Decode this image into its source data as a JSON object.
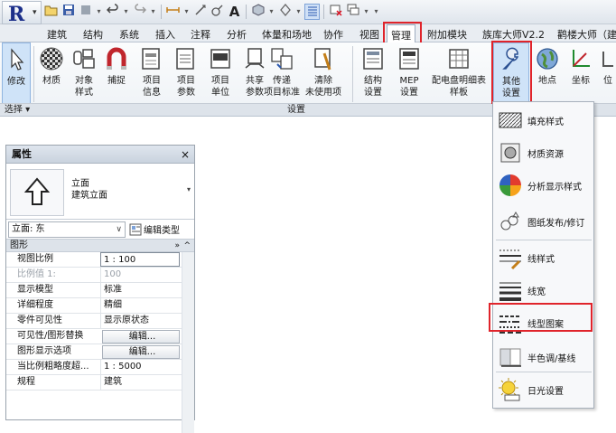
{
  "colors": {
    "highlight_box": "#e0242b",
    "ribbon_bg": "#f0f3f6",
    "selected_button": "#cfe3f8",
    "logo_letter": "#1c2f8a"
  },
  "app": {
    "logo_letter": "R"
  },
  "tabs": [
    {
      "label": "建筑"
    },
    {
      "label": "结构"
    },
    {
      "label": "系统"
    },
    {
      "label": "插入"
    },
    {
      "label": "注释"
    },
    {
      "label": "分析"
    },
    {
      "label": "体量和场地"
    },
    {
      "label": "协作"
    },
    {
      "label": "视图"
    },
    {
      "label": "管理"
    },
    {
      "label": "附加模块"
    },
    {
      "label": "族库大师V2.2"
    },
    {
      "label": "鹳楼大师（建"
    }
  ],
  "active_tab": "管理",
  "quick_access": {
    "text_tool": "A"
  },
  "ribbon": {
    "buttons": [
      {
        "label": "修改",
        "icon": "cursor-arrow-icon"
      },
      {
        "label": "材质",
        "icon": "material-sphere-icon"
      },
      {
        "label": "对象\n样式",
        "icon": "object-styles-icon"
      },
      {
        "label": "捕捉",
        "icon": "snap-magnet-icon"
      },
      {
        "label": "项目\n信息",
        "icon": "project-info-icon"
      },
      {
        "label": "项目\n参数",
        "icon": "project-parameters-icon"
      },
      {
        "label": "项目\n单位",
        "icon": "project-units-icon"
      },
      {
        "label": "共享\n参数",
        "icon": "shared-parameters-icon"
      },
      {
        "label": "传递\n项目标准",
        "icon": "transfer-standards-icon"
      },
      {
        "label": "清除\n未使用项",
        "icon": "purge-unused-icon"
      },
      {
        "label": "结构\n设置",
        "icon": "structural-settings-icon"
      },
      {
        "label": "MEP\n设置",
        "icon": "mep-settings-icon"
      },
      {
        "label": "配电盘明细表\n样板",
        "icon": "panel-schedule-icon"
      },
      {
        "label": "其他\n设置",
        "icon": "wrench-icon"
      },
      {
        "label": "地点",
        "icon": "globe-icon"
      },
      {
        "label": "坐标",
        "icon": "coordinates-icon"
      },
      {
        "label": "位",
        "icon": "position-icon"
      }
    ],
    "panels": {
      "select": "选择 ▾",
      "settings": "设置"
    }
  },
  "dropdown_menu": {
    "items": [
      {
        "label": "填充样式",
        "icon": "fill-pattern-icon"
      },
      {
        "label": "材质资源",
        "icon": "material-assets-icon"
      },
      {
        "label": "分析显示样式",
        "icon": "analysis-display-icon"
      },
      {
        "label": "图纸发布/修订",
        "icon": "sheet-issues-icon"
      },
      {
        "label": "线样式",
        "icon": "line-styles-icon"
      },
      {
        "label": "线宽",
        "icon": "line-weights-icon"
      },
      {
        "label": "线型图案",
        "icon": "line-patterns-icon"
      },
      {
        "label": "半色调/基线",
        "icon": "halftone-underlay-icon"
      },
      {
        "label": "日光设置",
        "icon": "sun-settings-icon"
      }
    ]
  },
  "properties": {
    "title": "属性",
    "close": "×",
    "type_family": "立面",
    "type_name": "建筑立面",
    "instance_selector": "立面: 东",
    "edit_type": "编辑类型",
    "group": "图形",
    "group_collapse": "»",
    "rows": [
      {
        "key": "视图比例",
        "value": "1 : 100",
        "kind": "boxed"
      },
      {
        "key": "比例值 1:",
        "value": "100",
        "kind": "dim"
      },
      {
        "key": "显示模型",
        "value": "标准",
        "kind": "text"
      },
      {
        "key": "详细程度",
        "value": "精细",
        "kind": "text"
      },
      {
        "key": "零件可见性",
        "value": "显示原状态",
        "kind": "text"
      },
      {
        "key": "可见性/图形替换",
        "value": "编辑...",
        "kind": "button"
      },
      {
        "key": "图形显示选项",
        "value": "编辑...",
        "kind": "button"
      },
      {
        "key": "当比例粗略度超...",
        "value": "1 : 5000",
        "kind": "text"
      },
      {
        "key": "规程",
        "value": "建筑",
        "kind": "text"
      }
    ]
  }
}
